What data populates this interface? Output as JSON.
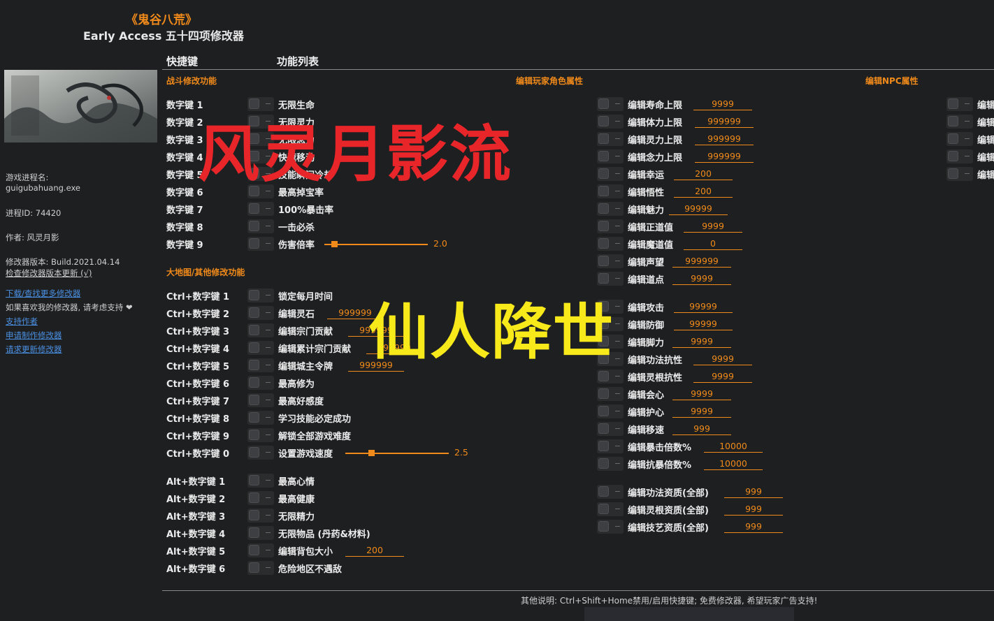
{
  "app": {
    "game_title": "《鬼谷八荒》",
    "subtitle": "Early Access 五十四项修改器"
  },
  "headers": {
    "hotkey": "快捷键",
    "features": "功能列表"
  },
  "sections": {
    "combat": "战斗修改功能",
    "player": "编辑玩家角色属性",
    "npc": "编辑NPC属性",
    "world": "大地图/其他修改功能"
  },
  "sidebar": {
    "process_label": "游戏进程名:",
    "process_name": "guigubahuang.exe",
    "pid": "进程ID: 74420",
    "author": "作者: 风灵月影",
    "version": "修改器版本: Build.2021.04.14",
    "check_update": "检查修改器版本更新 (√)",
    "links": [
      "下载/查找更多修改器",
      "支持作者",
      "申请制作修改器",
      "请求更新修改器"
    ],
    "support_text": "如果喜欢我的修改器, 请考虑支持 ❤"
  },
  "combat_rows": [
    {
      "key": "数字键 1",
      "label": "无限生命"
    },
    {
      "key": "数字键 2",
      "label": "无限灵力"
    },
    {
      "key": "数字键 3",
      "label": "无限念力"
    },
    {
      "key": "数字键 4",
      "label": "快速移动"
    },
    {
      "key": "数字键 5",
      "label": "技能瞬间冷却"
    },
    {
      "key": "数字键 6",
      "label": "最高掉宝率"
    },
    {
      "key": "数字键 7",
      "label": "100%暴击率"
    },
    {
      "key": "数字键 8",
      "label": "一击必杀"
    },
    {
      "key": "数字键 9",
      "label": "伤害倍率",
      "slider": "2.0"
    }
  ],
  "world_rows": [
    {
      "key": "Ctrl+数字键 1",
      "label": "锁定每月时间"
    },
    {
      "key": "Ctrl+数字键 2",
      "label": "编辑灵石",
      "value": "999999"
    },
    {
      "key": "Ctrl+数字键 3",
      "label": "编辑宗门贡献",
      "value": "999999"
    },
    {
      "key": "Ctrl+数字键 4",
      "label": "编辑累计宗门贡献",
      "value": "999999"
    },
    {
      "key": "Ctrl+数字键 5",
      "label": "编辑城主令牌",
      "value": "999999"
    },
    {
      "key": "Ctrl+数字键 6",
      "label": "最高修为"
    },
    {
      "key": "Ctrl+数字键 7",
      "label": "最高好感度"
    },
    {
      "key": "Ctrl+数字键 8",
      "label": "学习技能必定成功"
    },
    {
      "key": "Ctrl+数字键 9",
      "label": "解锁全部游戏难度"
    },
    {
      "key": "Ctrl+数字键 0",
      "label": "设置游戏速度",
      "slider": "2.5"
    }
  ],
  "alt_rows": [
    {
      "key": "Alt+数字键 1",
      "label": "最高心情"
    },
    {
      "key": "Alt+数字键 2",
      "label": "最高健康"
    },
    {
      "key": "Alt+数字键 3",
      "label": "无限精力"
    },
    {
      "key": "Alt+数字键 4",
      "label": "无限物品 (丹药&材料)"
    },
    {
      "key": "Alt+数字键 5",
      "label": "编辑背包大小",
      "value": "200"
    },
    {
      "key": "Alt+数字键 6",
      "label": "危险地区不遇敌"
    }
  ],
  "player_rows": [
    {
      "label": "编辑寿命上限",
      "value": "9999"
    },
    {
      "label": "编辑体力上限",
      "value": "999999"
    },
    {
      "label": "编辑灵力上限",
      "value": "999999"
    },
    {
      "label": "编辑念力上限",
      "value": "999999"
    },
    {
      "label": "编辑幸运",
      "value": "200"
    },
    {
      "label": "编辑悟性",
      "value": "200"
    },
    {
      "label": "编辑魅力",
      "value": "99999"
    },
    {
      "label": "编辑正道值",
      "value": "9999"
    },
    {
      "label": "编辑魔道值",
      "value": "0"
    },
    {
      "label": "编辑声望",
      "value": "999999"
    },
    {
      "label": "编辑道点",
      "value": "9999"
    },
    {
      "label": "编辑攻击",
      "value": "99999"
    },
    {
      "label": "编辑防御",
      "value": "99999"
    },
    {
      "label": "编辑脚力",
      "value": "9999"
    },
    {
      "label": "编辑功法抗性",
      "value": "9999"
    },
    {
      "label": "编辑灵根抗性",
      "value": "9999"
    },
    {
      "label": "编辑会心",
      "value": "9999"
    },
    {
      "label": "编辑护心",
      "value": "9999"
    },
    {
      "label": "编辑移速",
      "value": "999"
    },
    {
      "label": "编辑暴击倍数%",
      "value": "10000"
    },
    {
      "label": "编辑抗暴倍数%",
      "value": "10000"
    },
    {
      "label": "编辑功法资质(全部)",
      "value": "999"
    },
    {
      "label": "编辑灵根资质(全部)",
      "value": "999"
    },
    {
      "label": "编辑技艺资质(全部)",
      "value": "999"
    }
  ],
  "npc_rows": [
    {
      "label": "编辑"
    },
    {
      "label": "编辑"
    },
    {
      "label": "编辑"
    },
    {
      "label": "编辑"
    },
    {
      "label": "编辑"
    }
  ],
  "footer": "其他说明: Ctrl+Shift+Home禁用/启用快捷键; 免费修改器, 希望玩家广告支持!",
  "overlays": {
    "red": "风灵月影流",
    "yellow": "仙人降世"
  },
  "colors": {
    "accent": "#f08a1a",
    "background": "#1e1f21",
    "link": "#4a90e2"
  }
}
